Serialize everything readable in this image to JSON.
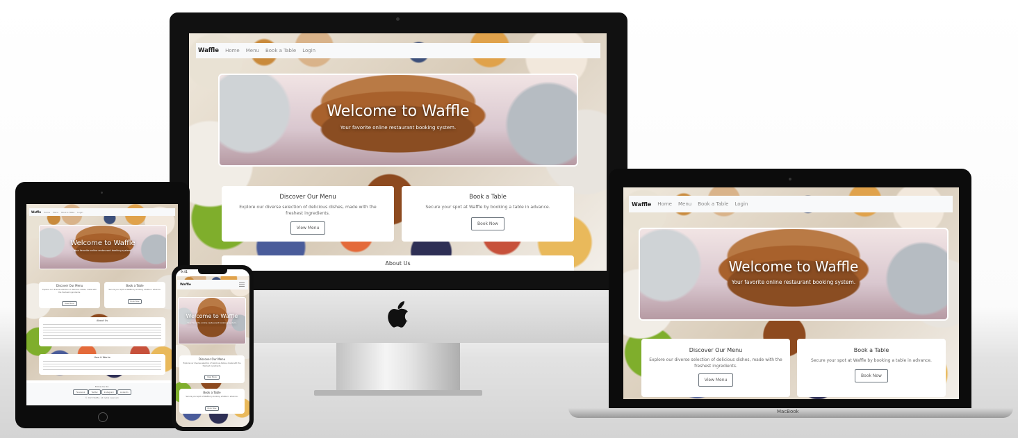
{
  "site": {
    "brand": "Waffle",
    "nav": [
      "Home",
      "Menu",
      "Book a Table",
      "Login"
    ],
    "hero_title": "Welcome to Waffle",
    "hero_subtitle": "Your favorite online restaurant booking system.",
    "cards": {
      "menu": {
        "title": "Discover Our Menu",
        "text": "Explore our diverse selection of delicious dishes, made with the freshest ingredients.",
        "button": "View Menu"
      },
      "book": {
        "title": "Book a Table",
        "text": "Secure your spot at Waffle by booking a table in advance.",
        "button": "Book Now"
      },
      "about": {
        "title": "About Us"
      },
      "howitworks": {
        "title": "How it Works"
      }
    },
    "footer": {
      "follow": "Follow Us On:",
      "social": [
        "Facebook",
        "Twitter",
        "Instagram",
        "LinkedIn"
      ],
      "copyright": "© 2023 Waffle. All rights reserved."
    }
  },
  "devices": {
    "macbook_label": "MacBook",
    "phone_time": "9:41"
  },
  "icons": {
    "apple": "apple-logo-icon",
    "hamburger": "hamburger-menu-icon"
  },
  "colors": {
    "navbar": "#f8f9fa",
    "card": "#ffffff",
    "button_border": "#6c757d"
  }
}
